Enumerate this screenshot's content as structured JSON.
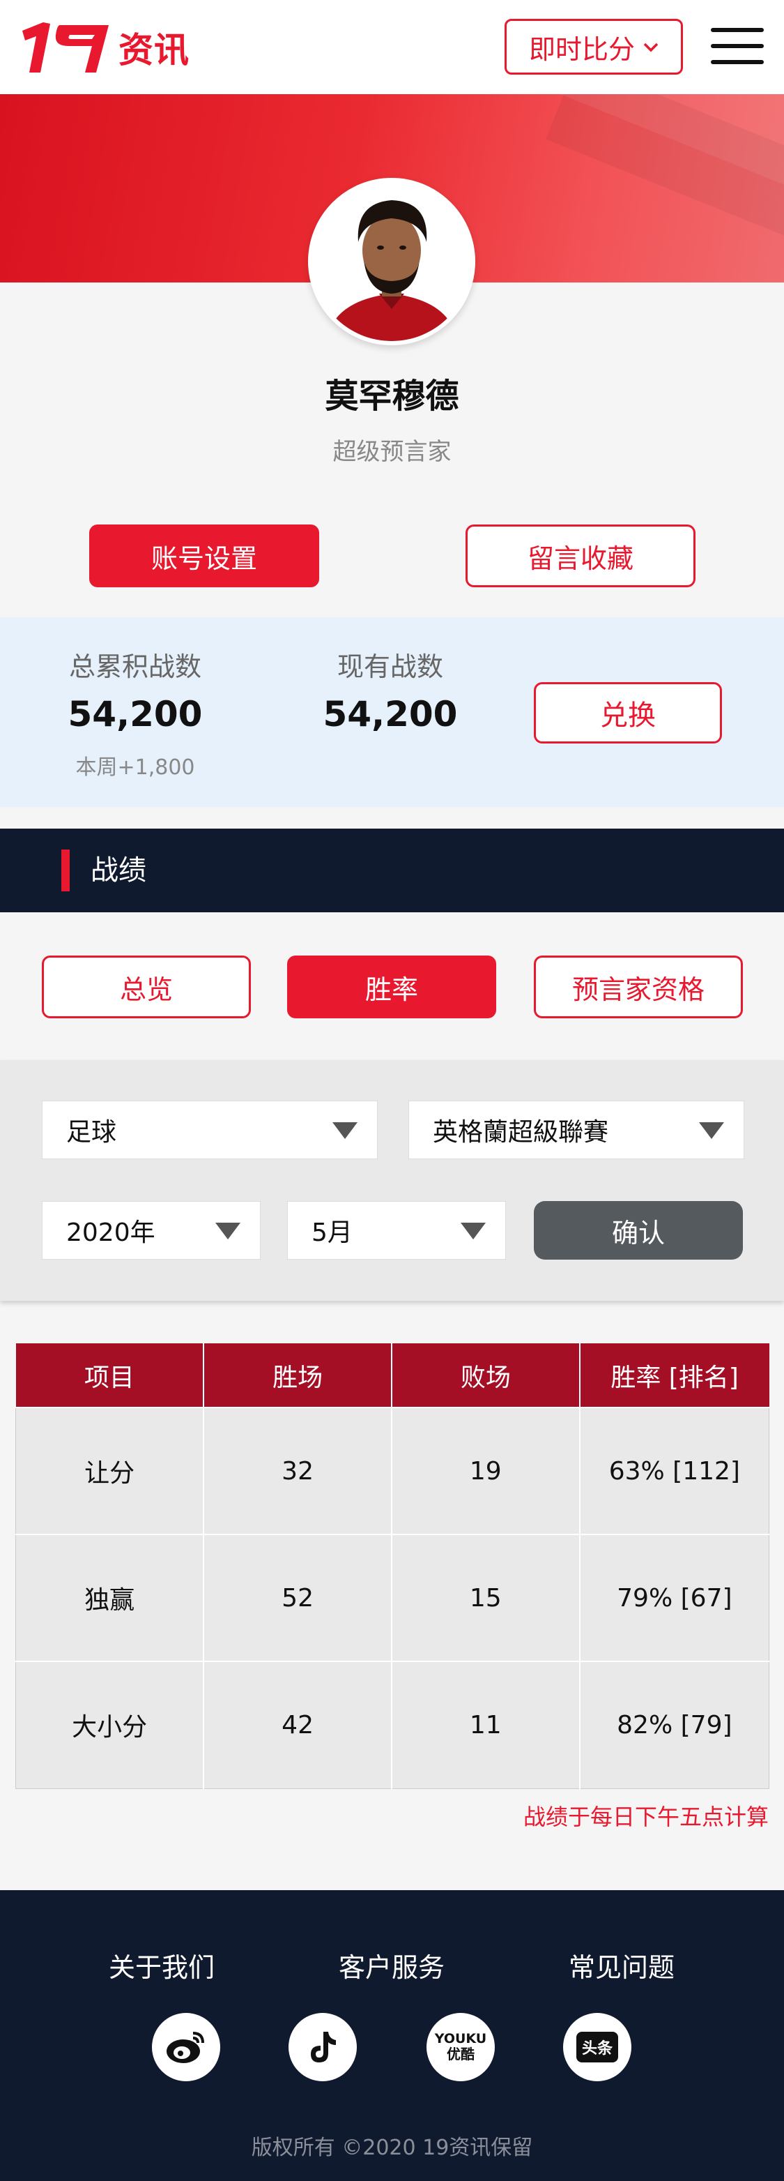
{
  "header": {
    "logo_text": "资讯",
    "logo_mark": "19",
    "live_select_label": "即时比分"
  },
  "profile": {
    "name": "莫罕穆德",
    "rank": "超级预言家",
    "account_settings": "账号设置",
    "saved_messages": "留言收藏"
  },
  "stats": {
    "total_label": "总累积战数",
    "total_value": "54,200",
    "weekly_delta": "本周+1,800",
    "current_label": "现有战数",
    "current_value": "54,200",
    "redeem_label": "兑换"
  },
  "section": {
    "title": "战绩"
  },
  "tabs": [
    {
      "label": "总览",
      "active": false
    },
    {
      "label": "胜率",
      "active": true
    },
    {
      "label": "预言家资格",
      "active": false
    }
  ],
  "filters": {
    "sport": "足球",
    "league": "英格蘭超級聯賽",
    "year": "2020年",
    "month": "5月",
    "confirm": "确认"
  },
  "table": {
    "headers": [
      "项目",
      "胜场",
      "败场",
      "胜率 [排名]"
    ],
    "rows": [
      [
        "让分",
        "32",
        "19",
        "63% [112]"
      ],
      [
        "独赢",
        "52",
        "15",
        "79% [67]"
      ],
      [
        "大小分",
        "42",
        "11",
        "82% [79]"
      ]
    ],
    "note": "战绩于每日下午五点计算"
  },
  "footer": {
    "links": [
      "关于我们",
      "客户服务",
      "常见问题"
    ],
    "socials": [
      {
        "icon": "weibo-icon"
      },
      {
        "icon": "tiktok-icon"
      },
      {
        "icon": "youku-icon",
        "label_line1": "YOUKU",
        "label_line2": "优酷"
      },
      {
        "icon": "toutiao-icon",
        "label": "头条"
      }
    ],
    "copyright": "版权所有 ©2020 19资讯保留"
  },
  "colors": {
    "brand_red": "#e8192f",
    "table_header": "#a50f26",
    "navy": "#101a2e",
    "stats_bg": "#e7f1fb"
  }
}
